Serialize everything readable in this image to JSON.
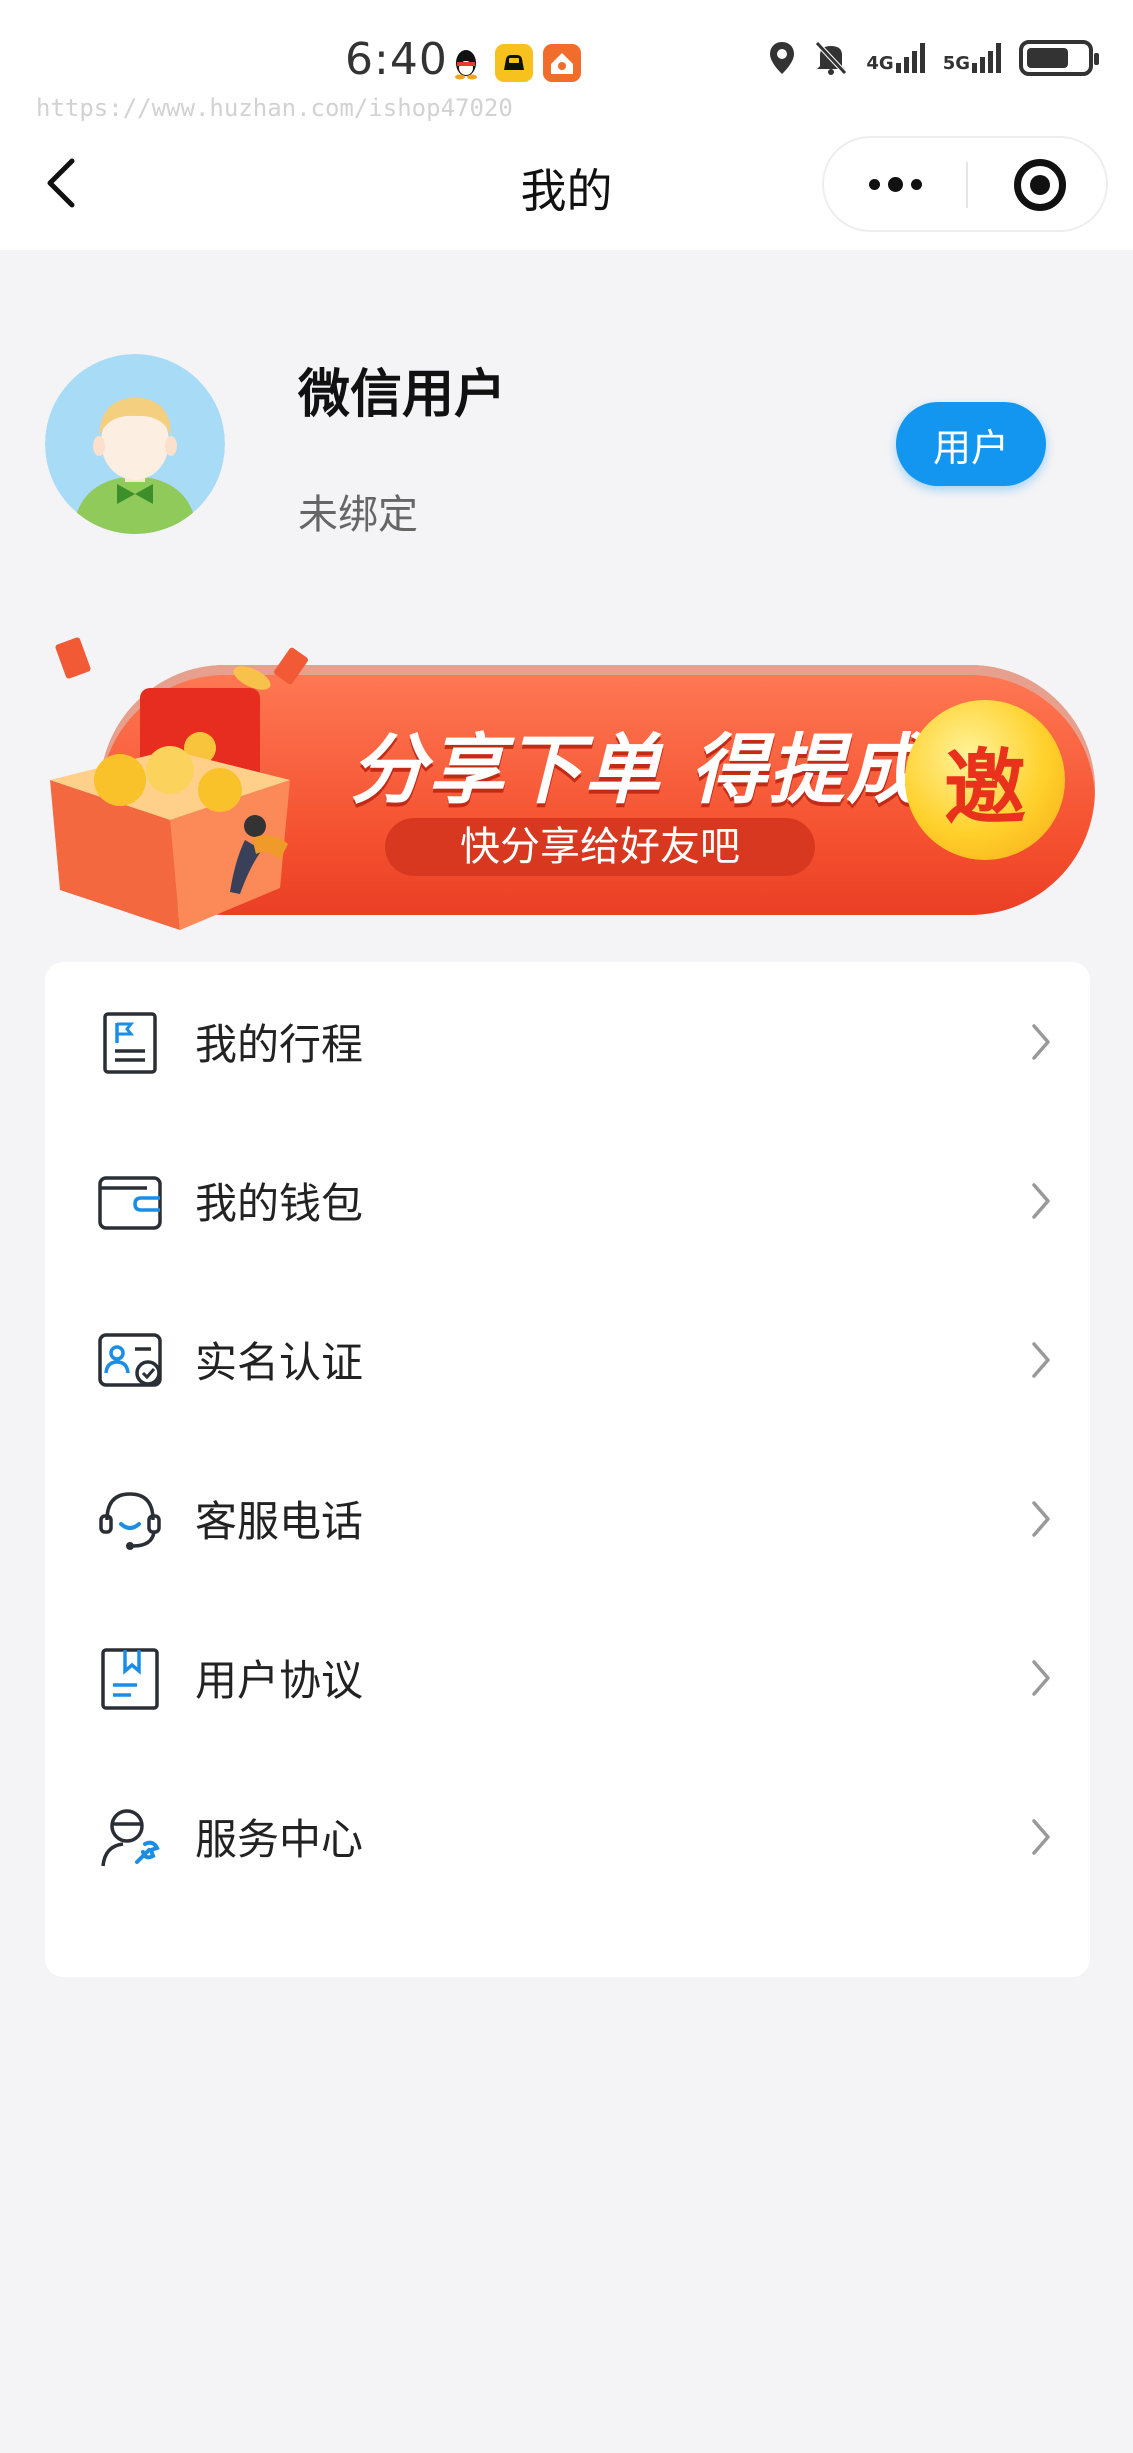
{
  "status_bar": {
    "time": "6:40",
    "network_1": "4G",
    "network_2": "5G",
    "battery_level": 0.7
  },
  "watermark": "https://www.huzhan.com/ishop47020",
  "header": {
    "title": "我的"
  },
  "profile": {
    "nickname": "微信用户",
    "bind_status": "未绑定",
    "role_badge": "用户"
  },
  "banner": {
    "headline": "分享下单 得提成",
    "subline": "快分享给好友吧",
    "coin_char": "邀"
  },
  "menu": [
    {
      "label": "我的行程",
      "icon": "trip-flag-icon"
    },
    {
      "label": "我的钱包",
      "icon": "wallet-icon"
    },
    {
      "label": "实名认证",
      "icon": "id-card-icon"
    },
    {
      "label": "客服电话",
      "icon": "headset-icon"
    },
    {
      "label": "用户协议",
      "icon": "agreement-bookmark-icon"
    },
    {
      "label": "服务中心",
      "icon": "service-person-icon"
    }
  ],
  "colors": {
    "accent": "#1296f0",
    "banner_red": "#f4502f",
    "background": "#f4f4f6"
  }
}
